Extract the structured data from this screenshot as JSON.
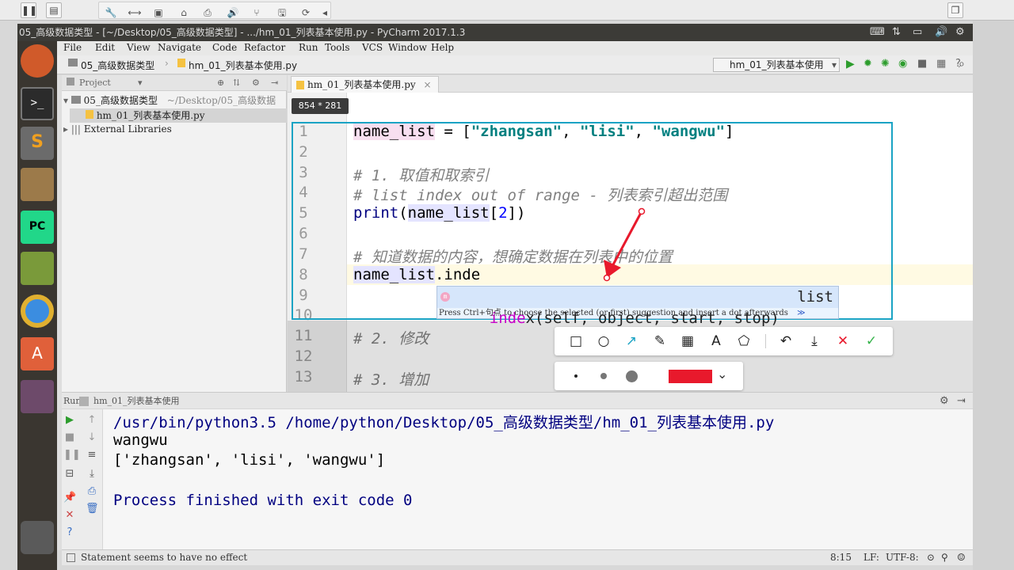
{
  "window": {
    "title": "05_高级数据类型 - [~/Desktop/05_高级数据类型] - .../hm_01_列表基本使用.py - PyCharm 2017.1.3"
  },
  "menu": [
    "File",
    "Edit",
    "View",
    "Navigate",
    "Code",
    "Refactor",
    "Run",
    "Tools",
    "VCS",
    "Window",
    "Help"
  ],
  "breadcrumb": {
    "project": "05_高级数据类型",
    "file": "hm_01_列表基本使用.py"
  },
  "run_config": {
    "name": "hm_01_列表基本使用"
  },
  "project_panel": {
    "header": "Project",
    "root_name": "05_高级数据类型",
    "root_path": "~/Desktop/05_高级数据",
    "file": "hm_01_列表基本使用.py",
    "external": "External Libraries"
  },
  "editor": {
    "tab": "hm_01_列表基本使用.py",
    "selection_size": "854 * 281",
    "line_numbers": [
      "1",
      "2",
      "3",
      "4",
      "5",
      "6",
      "7",
      "8",
      "9",
      "10",
      "11",
      "12",
      "13"
    ],
    "lines": {
      "l1_var": "name_list",
      "l1_eq": " = [",
      "l1_s1": "\"zhangsan\"",
      "l1_c1": ", ",
      "l1_s2": "\"lisi\"",
      "l1_c2": ", ",
      "l1_s3": "\"wangwu\"",
      "l1_end": "]",
      "l3": "# 1. 取值和取索引",
      "l4": "# list index out of range - 列表索引超出范围",
      "l5_print": "print",
      "l5_open": "(",
      "l5_var": "name_list",
      "l5_idx_open": "[",
      "l5_num": "2",
      "l5_close": "])",
      "l7": "# 知道数据的内容，想确定数据在列表中的位置",
      "l8_var": "name_list",
      "l8_rest": ".inde",
      "l11": "# 2. 修改",
      "l13": "# 3. 增加"
    }
  },
  "completion": {
    "match": "inde",
    "rest": "x(self, object, start, stop)",
    "type": "list",
    "hint": "Press Ctrl+句点 to choose the selected (or first) suggestion and insert a dot afterwards",
    "hint_link": "≫",
    "badge": "m"
  },
  "run_panel": {
    "label": "Run",
    "config": "hm_01_列表基本使用",
    "output": [
      "/usr/bin/python3.5 /home/python/Desktop/05_高级数据类型/hm_01_列表基本使用.py",
      "wangwu",
      "['zhangsan', 'lisi', 'wangwu']",
      "",
      "Process finished with exit code 0"
    ]
  },
  "status": {
    "message": "Statement seems to have no effect",
    "position": "8:15",
    "line_sep": "LF:",
    "encoding": "UTF-8:"
  },
  "annotation": {
    "color": "#e8192c"
  }
}
